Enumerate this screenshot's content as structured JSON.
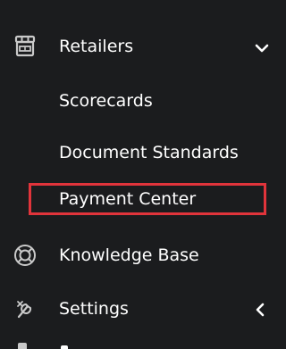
{
  "sidebar": {
    "retailers": {
      "label": "Retailers",
      "icon": "storefront-icon",
      "expand_icon": "chevron-down-icon",
      "children": [
        {
          "label": "Scorecards"
        },
        {
          "label": "Document Standards"
        },
        {
          "label": "Payment Center",
          "highlighted": true
        }
      ]
    },
    "knowledge_base": {
      "label": "Knowledge Base",
      "icon": "lifebuoy-icon"
    },
    "settings": {
      "label": "Settings",
      "icon": "tools-icon",
      "expand_icon": "chevron-left-icon"
    }
  },
  "colors": {
    "background": "#1b1c1e",
    "text": "#ffffff",
    "icon": "#c9c9c9",
    "highlight_border": "#e1343b"
  }
}
